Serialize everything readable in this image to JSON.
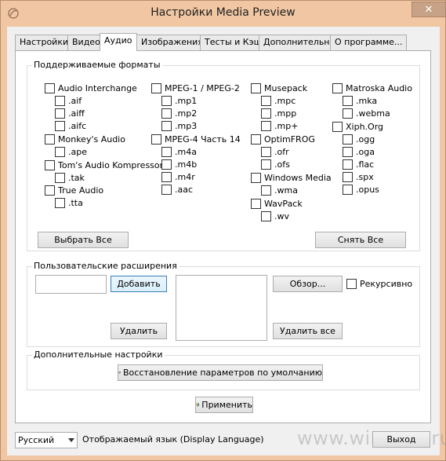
{
  "window": {
    "title": "Настройки Media Preview",
    "close_glyph": "✕"
  },
  "tabs": [
    {
      "label": "Настройки",
      "active": false
    },
    {
      "label": "Видео",
      "active": false
    },
    {
      "label": "Аудио",
      "active": true
    },
    {
      "label": "Изображения",
      "active": false
    },
    {
      "label": "Тесты и Кэш",
      "active": false
    },
    {
      "label": "Дополнительно",
      "active": false
    },
    {
      "label": "О программе...",
      "active": false
    }
  ],
  "formats": {
    "group_label": "Поддерживаемые форматы",
    "col1": [
      {
        "label": "Audio Interchange",
        "exts": [
          ".aif",
          ".aiff",
          ".aifc"
        ]
      },
      {
        "label": "Monkey's Audio",
        "exts": [
          ".ape"
        ]
      },
      {
        "label": "Tom's Audio Kompressor",
        "exts": [
          ".tak"
        ]
      },
      {
        "label": "True Audio",
        "exts": [
          ".tta"
        ]
      }
    ],
    "col2": [
      {
        "label": "MPEG-1 / MPEG-2",
        "exts": [
          ".mp1",
          ".mp2",
          ".mp3"
        ]
      },
      {
        "label": "MPEG-4 Часть 14",
        "exts": [
          ".m4a",
          ".m4b",
          ".m4r",
          ".aac"
        ]
      }
    ],
    "col3": [
      {
        "label": "Musepack",
        "exts": [
          ".mpc",
          ".mpp",
          ".mp+"
        ]
      },
      {
        "label": "OptimFROG",
        "exts": [
          ".ofr",
          ".ofs"
        ]
      },
      {
        "label": "Windows Media",
        "exts": [
          ".wma"
        ]
      },
      {
        "label": "WavPack",
        "exts": [
          ".wv"
        ]
      }
    ],
    "col4": [
      {
        "label": "Matroska Audio",
        "exts": [
          ".mka",
          ".webma"
        ]
      },
      {
        "label": "Xiph.Org",
        "exts": [
          ".ogg",
          ".oga",
          ".flac",
          ".spx",
          ".opus"
        ]
      }
    ],
    "select_all": "Выбрать Все",
    "deselect_all": "Снять Все"
  },
  "custom_ext": {
    "group_label": "Пользовательские расширения",
    "input_value": "",
    "add": "Добавить",
    "remove": "Удалить",
    "browse": "Обзор...",
    "recursive": "Рекурсивно",
    "remove_all": "Удалить все"
  },
  "advanced": {
    "group_label": "Дополнительные настройки",
    "restore_defaults": "Восстановление параметров по умолчанию"
  },
  "apply": "Применить",
  "language": {
    "selected": "Русский",
    "label": "Отображаемый язык (Display Language)"
  },
  "exit": "Выход",
  "watermark": "www.wincore.ru"
}
